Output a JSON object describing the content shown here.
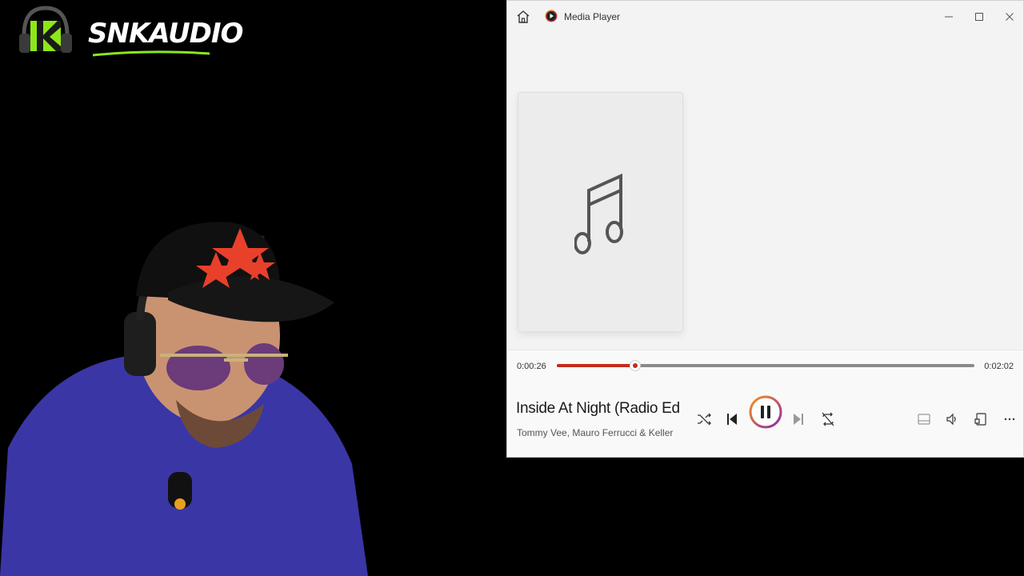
{
  "overlay": {
    "logo_text": "SNKAUDIO",
    "logo_icon": "headphones-logo-icon",
    "brand_colors": {
      "green": "#8ee619",
      "white": "#ffffff"
    }
  },
  "window": {
    "app_title": "Media Player",
    "icons": {
      "home": "home-icon",
      "app": "media-player-icon",
      "minimize": "minimize-icon",
      "maximize": "maximize-icon",
      "close": "close-icon"
    }
  },
  "album_art": {
    "icon": "music-note-icon"
  },
  "playback": {
    "current_time": "0:00:26",
    "total_time": "0:02:02",
    "progress": 0.187,
    "accent_color": "#c42b1c"
  },
  "track": {
    "title": "Inside At Night (Radio Edi...",
    "artist": "Tommy Vee, Mauro Ferrucci & Keller"
  },
  "controls": {
    "shuffle": "shuffle-icon",
    "previous": "previous-track-icon",
    "play_pause": "pause-icon",
    "next": "next-track-icon",
    "repeat": "repeat-off-icon",
    "miniplayer": "miniplayer-icon",
    "volume": "volume-icon",
    "cast": "cast-icon",
    "more": "more-options-icon"
  }
}
